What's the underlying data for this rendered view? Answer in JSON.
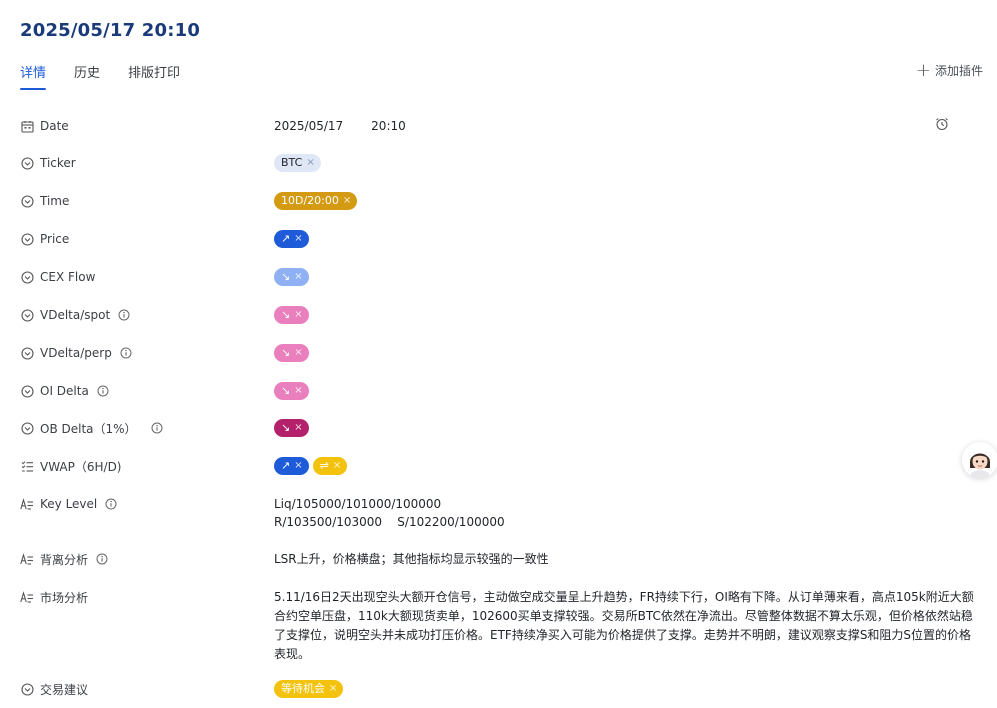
{
  "header": {
    "title": "2025/05/17 20:10"
  },
  "tabs": [
    {
      "label": "详情",
      "active": true
    },
    {
      "label": "历史",
      "active": false
    },
    {
      "label": "排版打印",
      "active": false
    }
  ],
  "add_plugin_label": "添加插件",
  "fields": {
    "date": {
      "label": "Date",
      "date": "2025/05/17",
      "time": "20:10"
    },
    "ticker": {
      "label": "Ticker",
      "tag": "BTC"
    },
    "time": {
      "label": "Time",
      "tag": "10D/20:00"
    },
    "price": {
      "label": "Price",
      "tag": "↗",
      "color": "#1e5bd8"
    },
    "cex_flow": {
      "label": "CEX Flow",
      "tag": "↘",
      "color": "#8fb0f2"
    },
    "vdelta_spot": {
      "label": "VDelta/spot",
      "tag": "↘",
      "color": "#ea7fbe"
    },
    "vdelta_perp": {
      "label": "VDelta/perp",
      "tag": "↘",
      "color": "#ea7fbe"
    },
    "oi_delta": {
      "label": "OI Delta",
      "tag": "↘",
      "color": "#ea7fbe"
    },
    "ob_delta": {
      "label": "OB Delta（1%）",
      "tag": "↘",
      "color": "#b3206b"
    },
    "vwap": {
      "label": "VWAP（6H/D)",
      "tags": [
        "↗",
        "⇌"
      ]
    },
    "key_level": {
      "label": "Key Level",
      "line1": "Liq/105000/101000/100000",
      "line2": "R/103500/103000    S/102200/100000"
    },
    "divergence": {
      "label": "背离分析",
      "text": "LSR上升，价格横盘；其他指标均显示较强的一致性"
    },
    "market": {
      "label": "市场分析",
      "text": "5.11/16日2天出现空头大额开仓信号，主动做空成交量呈上升趋势，FR持续下行，OI略有下降。从订单薄来看，高点105k附近大额合约空单压盘，110k大额现货卖单，102600买单支撑较强。交易所BTC依然在净流出。尽管整体数据不算太乐观，但价格依然站稳了支撑位，说明空头并未成功打压价格。ETF持续净买入可能为价格提供了支撑。走势并不明朗，建议观察支撑S和阻力S位置的价格表现。"
    },
    "advice": {
      "label": "交易建议",
      "tag": "等待机会"
    }
  },
  "remove_glyph": "×"
}
